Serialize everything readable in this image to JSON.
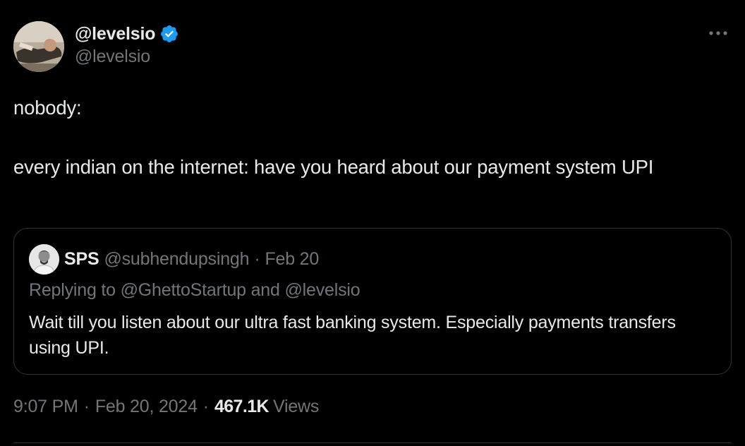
{
  "author": {
    "display_name": "@levelsio",
    "handle": "@levelsio",
    "verified_icon": "verified-badge-icon",
    "verified_color": "#1d9bf0",
    "avatar_icon": "profile-photo"
  },
  "menu": {
    "icon": "more-horizontal-icon"
  },
  "tweet": {
    "line1": "nobody:",
    "line2": "every indian on the internet: have you heard about our payment system UPI"
  },
  "quote": {
    "avatar_icon": "profile-photo",
    "name": "SPS",
    "handle": "@subhendupsingh",
    "separator": "·",
    "date": "Feb 20",
    "replying_prefix": "Replying to ",
    "replying_mention_1": "@GhettoStartup",
    "replying_and": " and ",
    "replying_mention_2": "@levelsio",
    "text": "Wait till you listen about our ultra fast banking system. Especially payments transfers using UPI."
  },
  "meta": {
    "time": "9:07 PM",
    "separator": "·",
    "date": "Feb 20, 2024",
    "views_count": "467.1K",
    "views_label": "Views"
  },
  "colors": {
    "background": "#000000",
    "text_primary": "#e7e9ea",
    "text_secondary": "#71767b",
    "border": "#2f3336"
  }
}
